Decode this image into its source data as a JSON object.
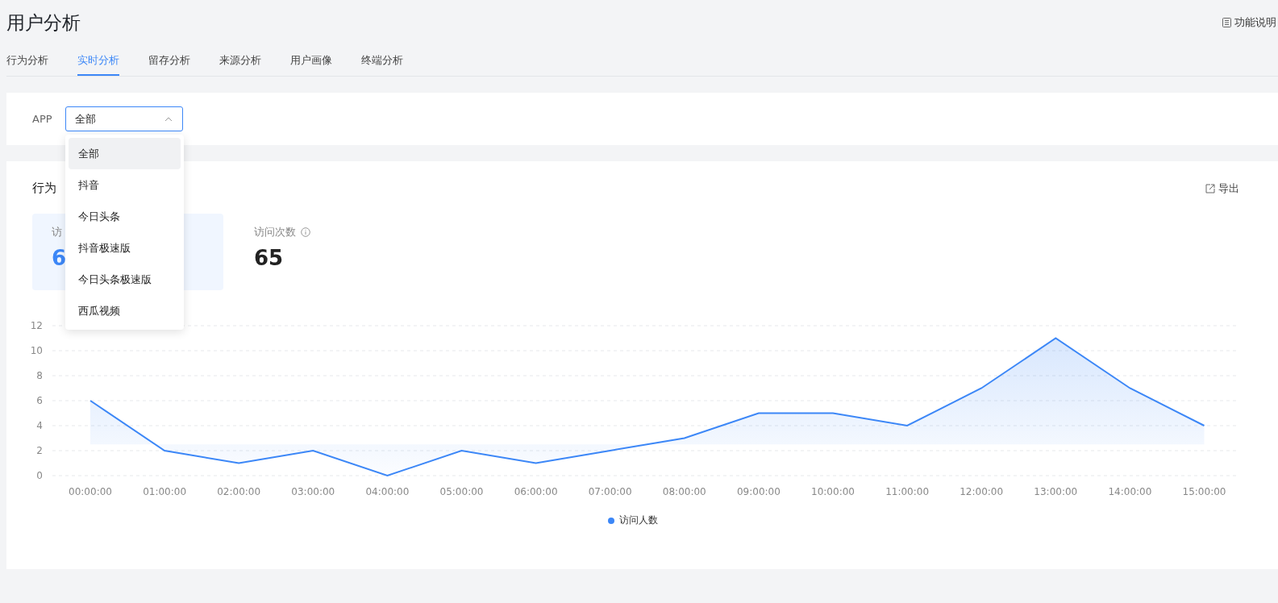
{
  "page": {
    "title": "用户分析",
    "help_link": "功能说明"
  },
  "tabs": [
    {
      "label": "行为分析",
      "selected": false
    },
    {
      "label": "实时分析",
      "selected": true
    },
    {
      "label": "留存分析",
      "selected": false
    },
    {
      "label": "来源分析",
      "selected": false
    },
    {
      "label": "用户画像",
      "selected": false
    },
    {
      "label": "终端分析",
      "selected": false
    }
  ],
  "filter": {
    "label": "APP",
    "value": "全部",
    "open": true,
    "options": [
      {
        "label": "全部",
        "selected": true
      },
      {
        "label": "抖音",
        "selected": false
      },
      {
        "label": "今日头条",
        "selected": false
      },
      {
        "label": "抖音极速版",
        "selected": false
      },
      {
        "label": "今日头条极速版",
        "selected": false
      },
      {
        "label": "西瓜视频",
        "selected": false
      }
    ]
  },
  "section": {
    "title": "行为",
    "export": "导出",
    "stats": [
      {
        "label": "访",
        "value": "6",
        "selected": true,
        "info": false
      },
      {
        "label": "访问次数",
        "value": "65",
        "selected": false,
        "info": true
      }
    ],
    "chart_data": {
      "type": "area",
      "categories": [
        "00:00:00",
        "01:00:00",
        "02:00:00",
        "03:00:00",
        "04:00:00",
        "05:00:00",
        "06:00:00",
        "07:00:00",
        "08:00:00",
        "09:00:00",
        "10:00:00",
        "11:00:00",
        "12:00:00",
        "13:00:00",
        "14:00:00",
        "15:00:00"
      ],
      "series": [
        {
          "name": "访问人数",
          "color": "#3c87f7",
          "values": [
            6,
            2,
            1,
            2,
            0,
            2,
            1,
            2,
            3,
            5,
            5,
            4,
            7,
            11,
            7,
            4
          ]
        }
      ],
      "grid": true,
      "ylim": [
        0,
        12
      ],
      "yticks": [
        0,
        2,
        4,
        6,
        8,
        10,
        12
      ]
    }
  }
}
